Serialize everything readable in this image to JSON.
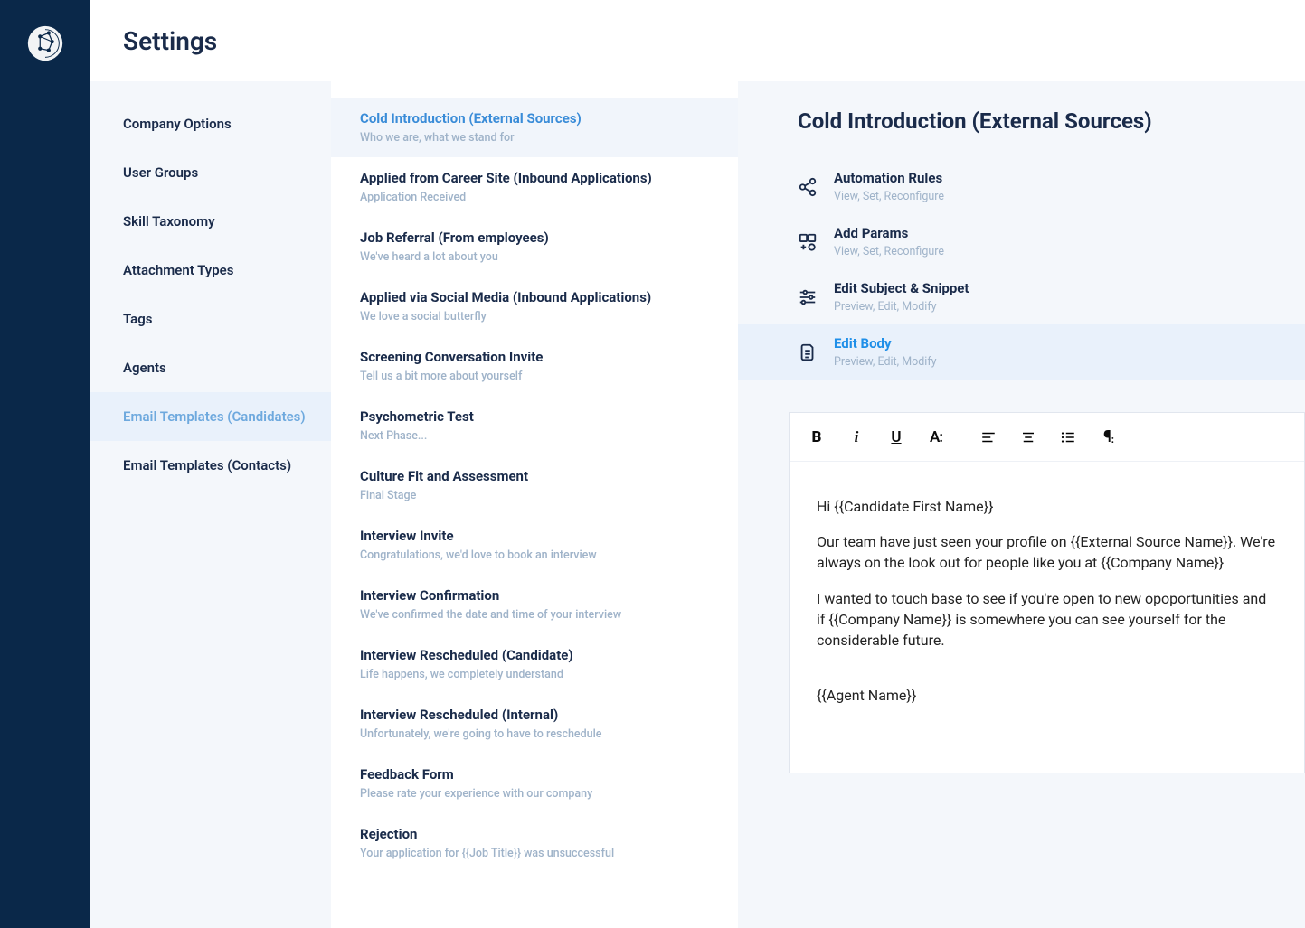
{
  "header": {
    "title": "Settings"
  },
  "settings_nav": {
    "items": [
      {
        "label": "Company Options"
      },
      {
        "label": "User Groups"
      },
      {
        "label": "Skill Taxonomy"
      },
      {
        "label": "Attachment Types"
      },
      {
        "label": "Tags"
      },
      {
        "label": "Agents"
      },
      {
        "label": "Email Templates (Candidates)",
        "active": true
      },
      {
        "label": "Email Templates (Contacts)"
      }
    ]
  },
  "templates": {
    "items": [
      {
        "title": "Cold Introduction  (External Sources)",
        "subtitle": "Who we are, what we stand for",
        "active": true
      },
      {
        "title": "Applied from Career Site  (Inbound Applications)",
        "subtitle": "Application Received"
      },
      {
        "title": "Job Referral  (From employees)",
        "subtitle": "We've heard a lot about you"
      },
      {
        "title": "Applied via Social Media  (Inbound Applications)",
        "subtitle": "We love a social butterfly"
      },
      {
        "title": "Screening Conversation Invite",
        "subtitle": "Tell us a bit more about yourself"
      },
      {
        "title": "Psychometric Test",
        "subtitle": "Next Phase..."
      },
      {
        "title": "Culture Fit and Assessment",
        "subtitle": "Final Stage"
      },
      {
        "title": "Interview Invite",
        "subtitle": "Congratulations, we'd love to book an interview"
      },
      {
        "title": "Interview Confirmation",
        "subtitle": "We've confirmed the date and time of your interview"
      },
      {
        "title": "Interview Rescheduled (Candidate)",
        "subtitle": "Life happens, we completely understand"
      },
      {
        "title": "Interview Rescheduled (Internal)",
        "subtitle": "Unfortunately, we're going to have to reschedule"
      },
      {
        "title": "Feedback Form",
        "subtitle": "Please rate your experience with our company"
      },
      {
        "title": "Rejection",
        "subtitle": "Your application for {{Job Title}} was unsuccessful"
      }
    ]
  },
  "detail": {
    "title": "Cold Introduction (External Sources)",
    "actions": [
      {
        "icon": "share-icon",
        "title": "Automation Rules",
        "subtitle": "View, Set, Reconfigure"
      },
      {
        "icon": "params-icon",
        "title": "Add Params",
        "subtitle": "View, Set, Reconfigure"
      },
      {
        "icon": "sliders-icon",
        "title": "Edit Subject & Snippet",
        "subtitle": "Preview, Edit, Modify"
      },
      {
        "icon": "document-icon",
        "title": "Edit Body",
        "subtitle": "Preview, Edit, Modify",
        "active": true
      }
    ],
    "toolbar": {
      "buttons": [
        {
          "name": "bold",
          "label": "B"
        },
        {
          "name": "italic",
          "label": "i"
        },
        {
          "name": "underline",
          "label": "U"
        },
        {
          "name": "font",
          "label": "A:"
        },
        {
          "name": "align-left",
          "label": ""
        },
        {
          "name": "align-center",
          "label": ""
        },
        {
          "name": "list",
          "label": ""
        },
        {
          "name": "paragraph",
          "label": ""
        }
      ]
    },
    "body": {
      "p1": "Hi {{Candidate First Name}}",
      "p2": "Our team have just seen your profile on {{External Source Name}}. We're always on the look out for people like you at {{Company Name}}",
      "p3": "I wanted to touch base to see if you're open to new opoportunities and if {{Company Name}} is somewhere you can see yourself for the considerable future.",
      "p4": "{{Agent Name}}"
    }
  }
}
